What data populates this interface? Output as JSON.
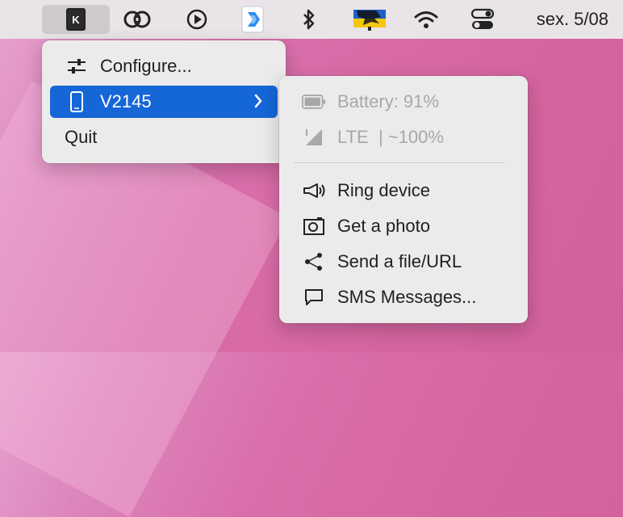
{
  "menubar": {
    "app_icon_letter": "K",
    "icons": [
      "kde-connect-icon",
      "creative-cloud-icon",
      "play-circle-icon",
      "dock-app-icon",
      "bluetooth-icon",
      "flag-icon",
      "wifi-icon",
      "control-center-icon"
    ],
    "clock": "sex. 5/08"
  },
  "main_menu": {
    "items": [
      {
        "label": "Configure...",
        "icon": "sliders-icon"
      },
      {
        "label": "V2145",
        "icon": "phone-icon",
        "selected": true
      },
      {
        "label": "Quit"
      }
    ]
  },
  "submenu": {
    "status": [
      {
        "label": "Battery: 91%",
        "icon": "battery-icon"
      },
      {
        "label": "LTE  | ~100%",
        "icon": "signal-icon"
      }
    ],
    "actions": [
      {
        "label": "Ring device",
        "icon": "megaphone-icon"
      },
      {
        "label": "Get a photo",
        "icon": "camera-icon"
      },
      {
        "label": "Send a file/URL",
        "icon": "share-icon"
      },
      {
        "label": "SMS Messages...",
        "icon": "message-icon"
      }
    ]
  },
  "colors": {
    "selection": "#1566d7",
    "wallpaper": "#d5659f"
  }
}
